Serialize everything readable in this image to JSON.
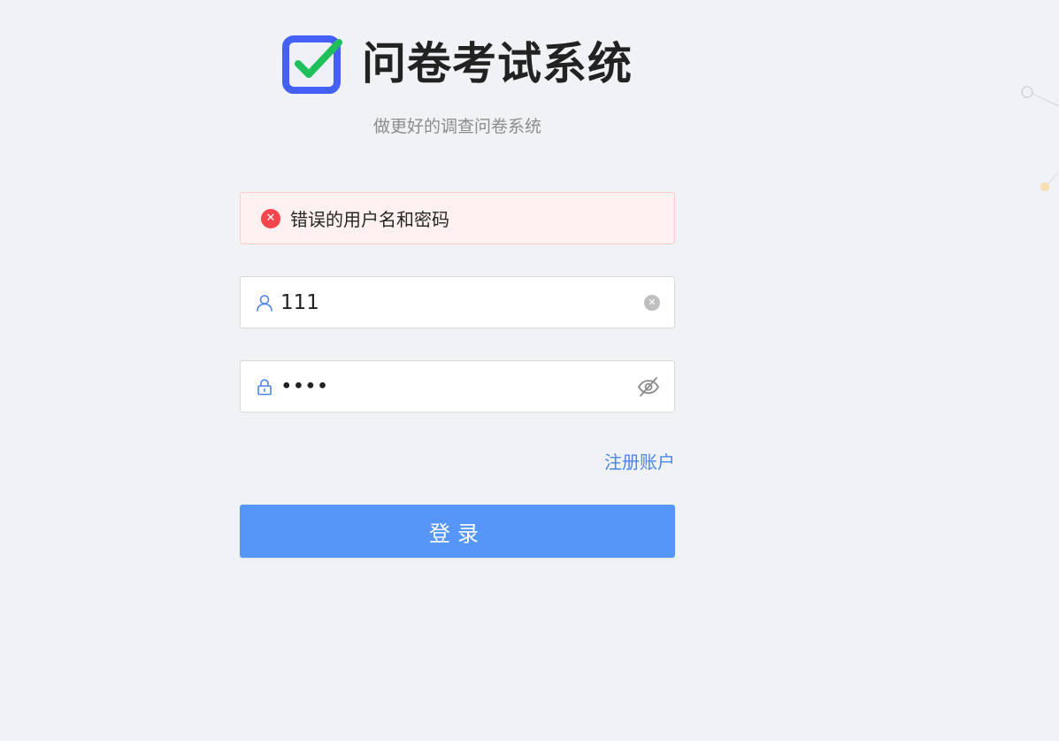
{
  "app": {
    "title": "问卷考试系统",
    "subtitle": "做更好的调查问卷系统"
  },
  "alert": {
    "message": "错误的用户名和密码",
    "icon": "error-circle-icon",
    "color": "#f5454f"
  },
  "username": {
    "value": "111",
    "icon": "user-icon"
  },
  "password": {
    "value": "1234",
    "icon": "lock-icon"
  },
  "register": {
    "label": "注册账户"
  },
  "login": {
    "label": "登录"
  },
  "colors": {
    "accent": "#5596f8",
    "link": "#4a86e8",
    "background": "#f0f2f5",
    "alert_background": "#fff1f0",
    "check_green": "#1fbf5b",
    "logo_blue": "#4560f7"
  }
}
